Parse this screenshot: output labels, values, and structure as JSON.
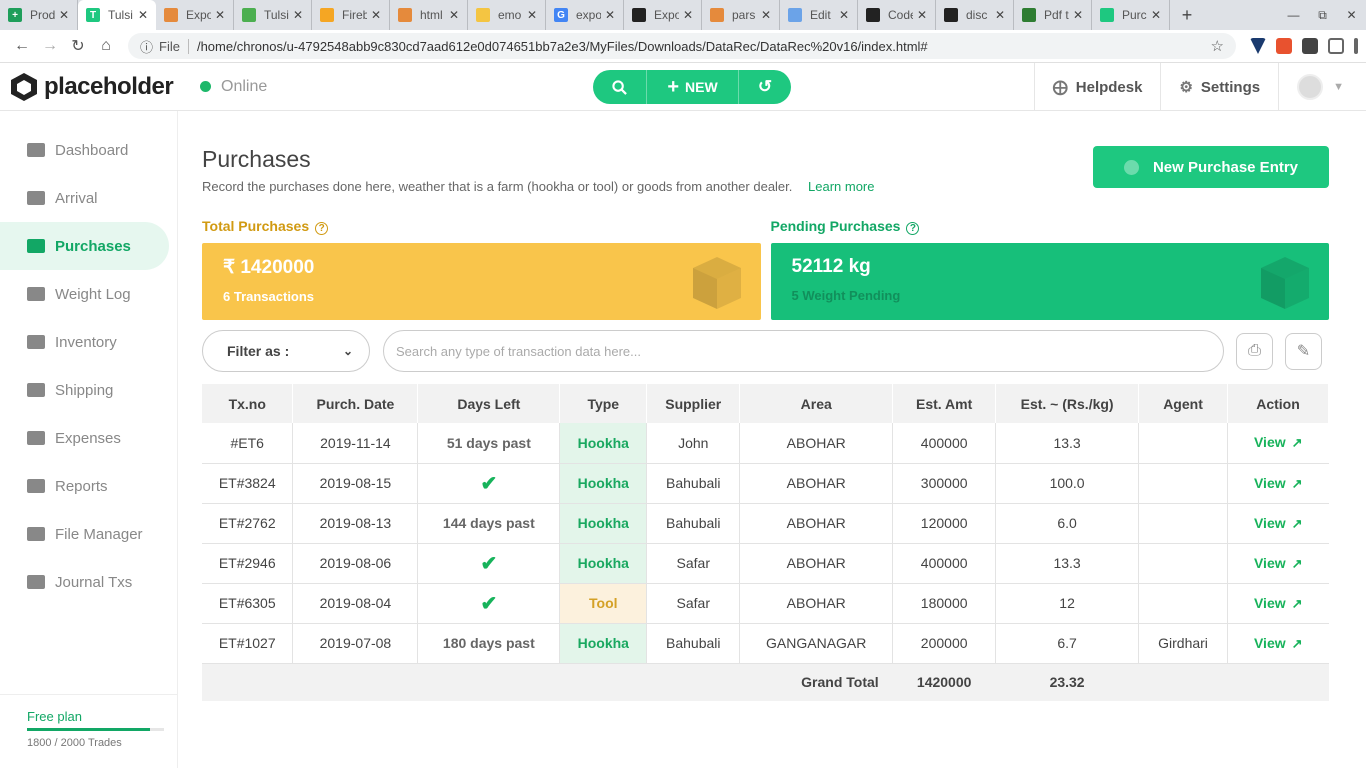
{
  "browser": {
    "tabs": [
      {
        "title": "Prod",
        "color": "#1e9e5a",
        "glyph": "+"
      },
      {
        "title": "Tulsi",
        "color": "#1ec880",
        "glyph": "T"
      },
      {
        "title": "Expo",
        "color": "#e58a3c",
        "glyph": ""
      },
      {
        "title": "Tulsi",
        "color": "#4caf50",
        "glyph": ""
      },
      {
        "title": "Fireb",
        "color": "#f5a623",
        "glyph": ""
      },
      {
        "title": "html",
        "color": "#e58a3c",
        "glyph": ""
      },
      {
        "title": "emo",
        "color": "#f4c542",
        "glyph": ""
      },
      {
        "title": "expo",
        "color": "#4285f4",
        "glyph": "G"
      },
      {
        "title": "Expo",
        "color": "#222222",
        "glyph": ""
      },
      {
        "title": "pars",
        "color": "#e58a3c",
        "glyph": ""
      },
      {
        "title": "Edit",
        "color": "#6ba3e8",
        "glyph": ""
      },
      {
        "title": "Code",
        "color": "#222222",
        "glyph": ""
      },
      {
        "title": "disc",
        "color": "#222222",
        "glyph": ""
      },
      {
        "title": "Pdf t",
        "color": "#2e7d32",
        "glyph": ""
      },
      {
        "title": "Purc",
        "color": "#1ec880",
        "glyph": ""
      }
    ],
    "active_tab": 1,
    "address_prefix": "File",
    "url": "/home/chronos/u-4792548abb9c830cd7aad612e0d074651bb7a2e3/MyFiles/Downloads/DataRec/DataRec%20v16/index.html#"
  },
  "header": {
    "brand": "placeholder",
    "status": "Online",
    "new_label": "NEW",
    "helpdesk": "Helpdesk",
    "settings": "Settings"
  },
  "sidebar": {
    "items": [
      {
        "label": "Dashboard",
        "icon": "dashboard-icon"
      },
      {
        "label": "Arrival",
        "icon": "arrival-icon"
      },
      {
        "label": "Purchases",
        "icon": "purchases-icon",
        "active": true
      },
      {
        "label": "Weight Log",
        "icon": "weight-icon"
      },
      {
        "label": "Inventory",
        "icon": "inventory-icon"
      },
      {
        "label": "Shipping",
        "icon": "truck-icon"
      },
      {
        "label": "Expenses",
        "icon": "expenses-icon"
      },
      {
        "label": "Reports",
        "icon": "pie-chart-icon"
      },
      {
        "label": "File Manager",
        "icon": "file-manager-icon"
      },
      {
        "label": "Journal Txs",
        "icon": "journal-icon"
      }
    ],
    "plan": {
      "title": "Free plan",
      "usage_text": "1800 / 2000 Trades",
      "usage_fraction": 0.9
    }
  },
  "page": {
    "title": "Purchases",
    "description": "Record the purchases done here, weather that is a farm (hookha or tool) or goods from another dealer.",
    "learn_more": "Learn more",
    "new_entry": "New Purchase Entry"
  },
  "cards": {
    "total": {
      "label": "Total Purchases",
      "value": "₹ 1420000",
      "sub": "6 Transactions",
      "color": "#f9c54b",
      "label_color": "#d19a12"
    },
    "pending": {
      "label": "Pending Purchases",
      "value": "52112 kg",
      "sub": "5 Weight Pending",
      "color": "#17bf7a",
      "label_color": "#12a765"
    }
  },
  "filters": {
    "filter_label": "Filter as :",
    "search_placeholder": "Search any type of transaction data here..."
  },
  "table": {
    "columns": [
      "Tx.no",
      "Purch. Date",
      "Days Left",
      "Type",
      "Supplier",
      "Area",
      "Est. Amt",
      "Est. ~ (Rs./kg)",
      "Agent",
      "Action"
    ],
    "rows": [
      {
        "txno": "#ET6",
        "date": "2019-11-14",
        "days_left": "51 days past",
        "done": false,
        "type": "Hookha",
        "supplier": "John",
        "area": "ABOHAR",
        "amt": "400000",
        "rate": "13.3",
        "agent": "",
        "action": "View"
      },
      {
        "txno": "ET#3824",
        "date": "2019-08-15",
        "days_left": "",
        "done": true,
        "type": "Hookha",
        "supplier": "Bahubali",
        "area": "ABOHAR",
        "amt": "300000",
        "rate": "100.0",
        "agent": "",
        "action": "View"
      },
      {
        "txno": "ET#2762",
        "date": "2019-08-13",
        "days_left": "144 days past",
        "done": false,
        "type": "Hookha",
        "supplier": "Bahubali",
        "area": "ABOHAR",
        "amt": "120000",
        "rate": "6.0",
        "agent": "",
        "action": "View"
      },
      {
        "txno": "ET#2946",
        "date": "2019-08-06",
        "days_left": "",
        "done": true,
        "type": "Hookha",
        "supplier": "Safar",
        "area": "ABOHAR",
        "amt": "400000",
        "rate": "13.3",
        "agent": "",
        "action": "View"
      },
      {
        "txno": "ET#6305",
        "date": "2019-08-04",
        "days_left": "",
        "done": true,
        "type": "Tool",
        "supplier": "Safar",
        "area": "ABOHAR",
        "amt": "180000",
        "rate": "12",
        "agent": "",
        "action": "View"
      },
      {
        "txno": "ET#1027",
        "date": "2019-07-08",
        "days_left": "180 days past",
        "done": false,
        "type": "Hookha",
        "supplier": "Bahubali",
        "area": "GANGANAGAR",
        "amt": "200000",
        "rate": "6.7",
        "agent": "Girdhari",
        "action": "View"
      }
    ],
    "total": {
      "label": "Grand Total",
      "amt": "1420000",
      "rate": "23.32"
    }
  }
}
